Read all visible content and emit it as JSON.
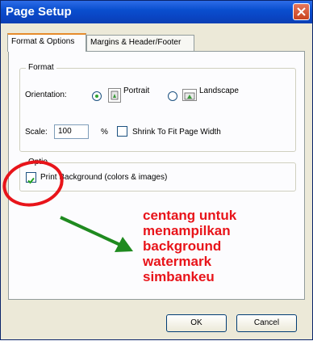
{
  "window": {
    "title": "Page Setup"
  },
  "tabs": [
    {
      "label": "Format & Options"
    },
    {
      "label": "Margins & Header/Footer"
    }
  ],
  "format_group": {
    "legend": "Format",
    "orientation_label": "Orientation:",
    "portrait_label": "Portrait",
    "landscape_label": "Landscape",
    "selected_orientation": "Portrait",
    "scale_label": "Scale:",
    "scale_value": "100",
    "percent": "%",
    "shrink_label": "Shrink To Fit Page Width",
    "shrink_checked": false
  },
  "options_group": {
    "legend": "Optio",
    "print_background_label": "Print Background (colors & images)",
    "print_background_checked": true
  },
  "annotation": {
    "line1": "centang untuk",
    "line2": "menampilkan",
    "line3": "background",
    "line4": "watermark",
    "line5": "simbankeu",
    "color": "#e8141a",
    "arrow_color": "#1f8a1f"
  },
  "buttons": {
    "ok": "OK",
    "cancel": "Cancel"
  }
}
